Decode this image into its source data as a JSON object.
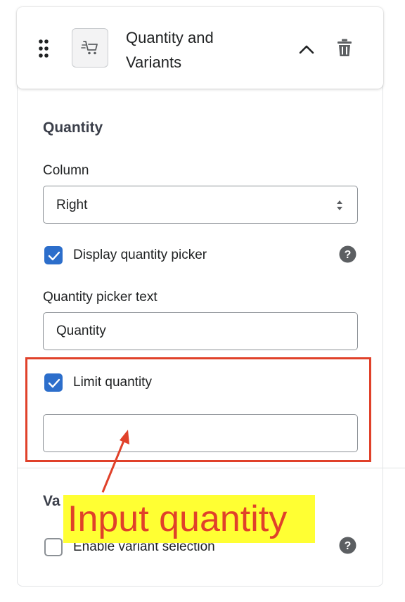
{
  "header": {
    "title": "Quantity and Variants",
    "drag_icon": "drag-handle-icon",
    "thumb_icon": "cart-icon",
    "collapse_icon": "chevron-up-icon",
    "delete_icon": "trash-icon"
  },
  "quantity_section": {
    "title": "Quantity",
    "column_label": "Column",
    "column_value": "Right",
    "display_picker_label": "Display quantity picker",
    "display_picker_checked": true,
    "picker_text_label": "Quantity picker text",
    "picker_text_value": "Quantity",
    "limit_label": "Limit quantity",
    "limit_checked": true,
    "limit_value": ""
  },
  "variants_section": {
    "title_visible": "Va",
    "enable_label": "Enable variant selection",
    "enable_checked": false
  },
  "annotation": {
    "callout_text": "Input quantity",
    "callout_color": "#e0412a",
    "callout_background": "#ffff33"
  },
  "colors": {
    "accent": "#2c6ecb",
    "border": "#8c9196",
    "highlight": "#e0412a"
  }
}
